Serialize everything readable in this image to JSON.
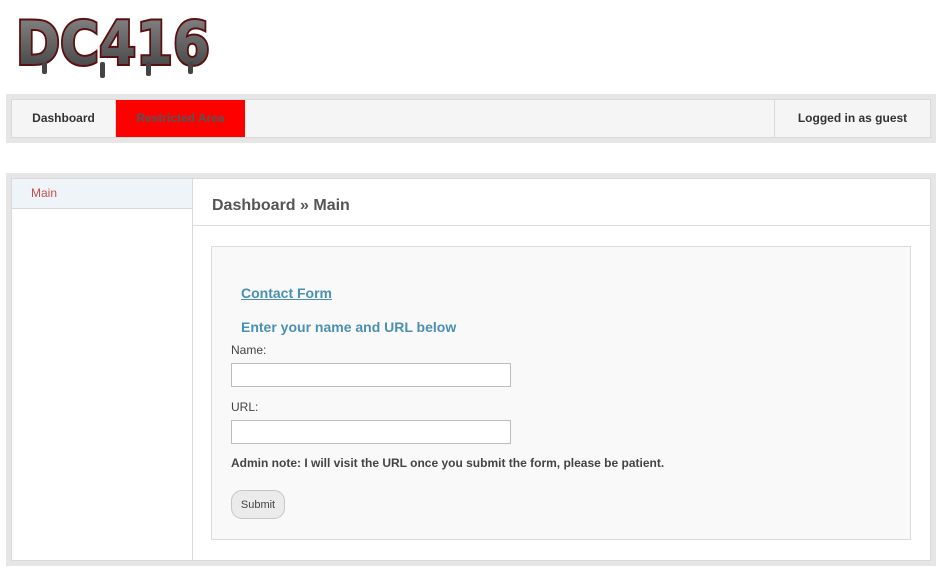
{
  "logo": {
    "text": "DC416"
  },
  "nav": {
    "dashboard": "Dashboard",
    "restricted": "Restricted Area",
    "user": "Logged in as guest"
  },
  "colors": {
    "restricted_bg": "#ff0000",
    "link": "#4a90b0",
    "sidebar_link": "#c0504d"
  },
  "sidebar": {
    "items": [
      {
        "label": "Main"
      }
    ]
  },
  "main": {
    "title": "Dashboard » Main",
    "form": {
      "link_text": "Contact Form",
      "heading": "Enter your name and URL below",
      "name_label": "Name:",
      "name_value": "",
      "url_label": "URL:",
      "url_value": "",
      "note": "Admin note: I will visit the URL once you submit the form, please be patient.",
      "submit": "Submit"
    }
  }
}
